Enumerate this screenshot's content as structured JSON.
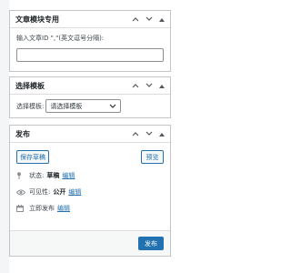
{
  "article_module": {
    "title": "文章模块专用",
    "field_label": "输入文章ID \",\"(英文逗号分隔):",
    "field_value": ""
  },
  "template_box": {
    "title": "选择模板",
    "label": "选择模板:",
    "selected": "请选择模板"
  },
  "publish": {
    "title": "发布",
    "save_draft": "保存草稿",
    "preview": "预览",
    "status_label": "状态:",
    "status_value": "草稿",
    "visibility_label": "可见性:",
    "visibility_value": "公开",
    "schedule_text": "立即发布",
    "edit_link": "编辑",
    "publish_button": "发布"
  },
  "colors": {
    "accent": "#2271b1",
    "border": "#c3c4c7",
    "footer_bg": "#f6f7f7"
  },
  "icons": [
    "chevron-up-icon",
    "chevron-down-icon",
    "triangle-up-icon",
    "pin-icon",
    "eye-icon",
    "calendar-icon"
  ]
}
